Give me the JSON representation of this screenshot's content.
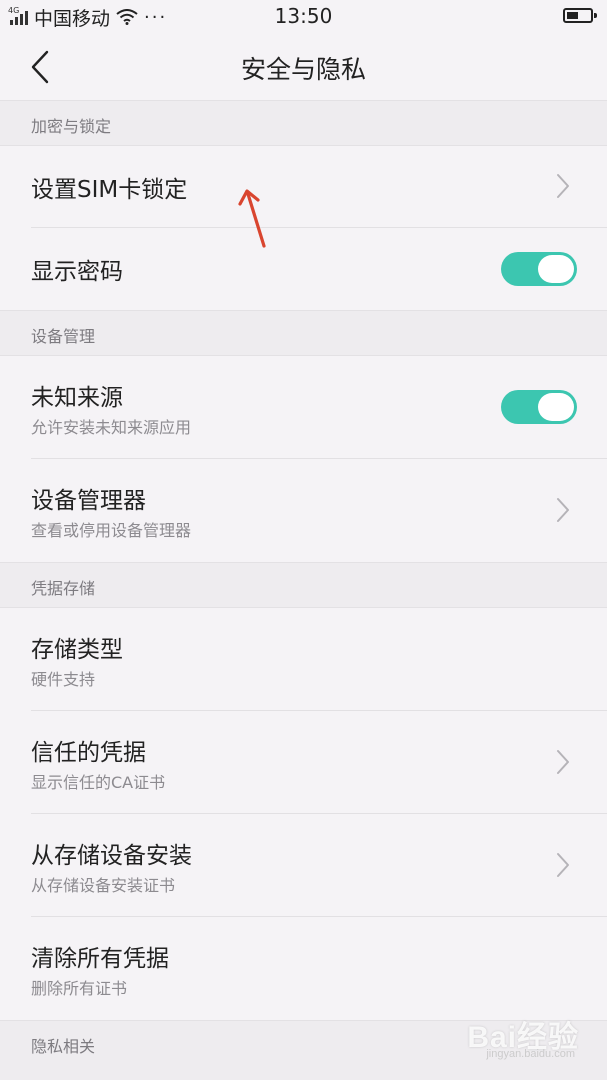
{
  "status_bar": {
    "network": "4G",
    "carrier": "中国移动",
    "more": "···",
    "time": "13:50"
  },
  "header": {
    "title": "安全与隐私"
  },
  "sections": [
    {
      "header": "加密与锁定",
      "items": [
        {
          "title": "设置SIM卡锁定",
          "control": "chevron"
        },
        {
          "title": "显示密码",
          "control": "toggle",
          "toggle_on": true
        }
      ]
    },
    {
      "header": "设备管理",
      "items": [
        {
          "title": "未知来源",
          "subtitle": "允许安装未知来源应用",
          "control": "toggle",
          "toggle_on": true
        },
        {
          "title": "设备管理器",
          "subtitle": "查看或停用设备管理器",
          "control": "chevron"
        }
      ]
    },
    {
      "header": "凭据存储",
      "items": [
        {
          "title": "存储类型",
          "subtitle": "硬件支持",
          "control": "none"
        },
        {
          "title": "信任的凭据",
          "subtitle": "显示信任的CA证书",
          "control": "chevron"
        },
        {
          "title": "从存储设备安装",
          "subtitle": "从存储设备安装证书",
          "control": "chevron"
        },
        {
          "title": "清除所有凭据",
          "subtitle": "删除所有证书",
          "control": "none"
        }
      ]
    },
    {
      "header": "隐私相关",
      "items": []
    }
  ],
  "watermark": {
    "brand": "Bai经验",
    "url": "jingyan.baidu.com"
  },
  "colors": {
    "background": "#f5f3f6",
    "section_header_bg": "#eeecef",
    "toggle_on": "#3cc6b0",
    "annotation_arrow": "#d9452f"
  },
  "icons": {
    "back": "chevron-left-icon",
    "row_nav": "chevron-right-icon",
    "annotation": "arrow-up-icon"
  }
}
